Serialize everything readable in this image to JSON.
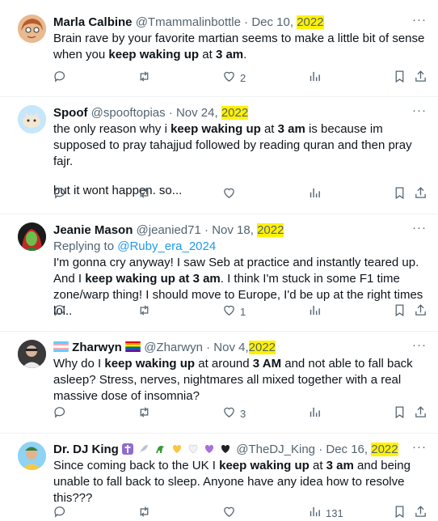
{
  "tweets": [
    {
      "name": "Marla Calbine",
      "handle": "@Tmammalinbottle",
      "dot": "·",
      "date_prefix": "Dec 10,",
      "year": "2022",
      "body": [
        "Brain rave by your favorite martian seems to make a little bit of sense when you ",
        "keep waking up",
        " at ",
        "3 am",
        "."
      ],
      "replies": "",
      "retweets": "",
      "likes": "2",
      "views": ""
    },
    {
      "name": "Spoof",
      "handle": "@spooftopias",
      "dot": "·",
      "date_prefix": "Nov 24,",
      "year": "2022",
      "body": [
        "the only reason why i ",
        "keep waking up",
        " at ",
        "3 am",
        " is because im supposed to pray tahajjud followed by reading quran and then pray fajr."
      ],
      "body2": "but it wont happen. so...",
      "replies": "",
      "retweets": "",
      "likes": "",
      "views": ""
    },
    {
      "name": "Jeanie Mason",
      "handle": "@jeanied71",
      "dot": "·",
      "date_prefix": "Nov 18,",
      "year": "2022",
      "reply_label": "Replying to",
      "reply_to": "@Ruby_era_2024",
      "body": [
        "I'm gonna cry anyway! I saw Seb at practice and instantly teared up. And I ",
        "keep waking up at 3 am",
        ". I think I'm stuck in some F1 time zone/warp thing! I should move to Europe, I'd be up at the right times lol.."
      ],
      "replies": "",
      "retweets": "",
      "likes": "1",
      "views": ""
    },
    {
      "name": "Zharwyn",
      "handle": "@Zharwyn",
      "dot": "·",
      "date_prefix": "Nov 4,",
      "year": "2022",
      "body": [
        "Why do I ",
        "keep waking up",
        " at around ",
        "3 AM",
        " and not able to fall back asleep? Stress, nerves, nightmares all mixed together with a real massive dose of insomnia?"
      ],
      "replies": "",
      "retweets": "",
      "likes": "3",
      "views": ""
    },
    {
      "name": "Dr. DJ King",
      "handle": "@TheDJ_King",
      "dot": "·",
      "date_prefix": "Dec 16,",
      "year": "2022",
      "body": [
        "Since coming back to the UK I ",
        "keep waking up",
        " at ",
        "3 am",
        " and being unable to fall back to sleep. Anyone have any idea how to resolve this???"
      ],
      "replies": "",
      "retweets": "",
      "likes": "",
      "views": "131"
    }
  ],
  "more_label": "···",
  "colors": {
    "highlight": "#fff200",
    "link": "#1d9bf0",
    "secondary": "#536471"
  }
}
